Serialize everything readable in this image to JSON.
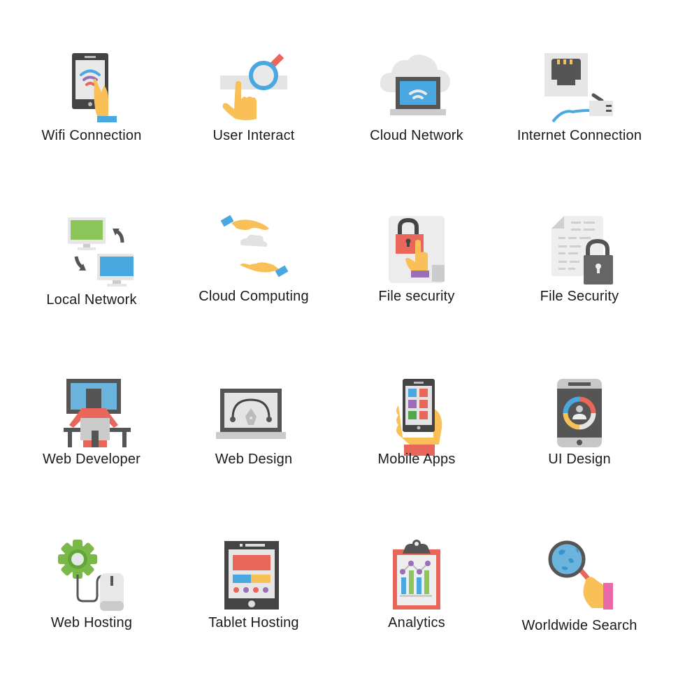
{
  "icons": [
    {
      "label": "Wifi Connection",
      "icon": "wifi-phone-icon"
    },
    {
      "label": "User Interact",
      "icon": "user-interact-icon"
    },
    {
      "label": "Cloud Network",
      "icon": "cloud-network-icon"
    },
    {
      "label": "Internet Connection",
      "icon": "ethernet-icon"
    },
    {
      "label": "Local Network",
      "icon": "local-network-icon"
    },
    {
      "label": "Cloud Computing",
      "icon": "cloud-hands-icon"
    },
    {
      "label": "File security",
      "icon": "file-lock-touch-icon"
    },
    {
      "label": "File Security",
      "icon": "document-lock-icon"
    },
    {
      "label": "Web Developer",
      "icon": "web-developer-icon"
    },
    {
      "label": "Web Design",
      "icon": "web-design-icon"
    },
    {
      "label": "Mobile Apps",
      "icon": "mobile-apps-icon"
    },
    {
      "label": "UI Design",
      "icon": "ui-design-icon"
    },
    {
      "label": "Web Hosting",
      "icon": "web-hosting-icon"
    },
    {
      "label": "Tablet Hosting",
      "icon": "tablet-hosting-icon"
    },
    {
      "label": "Analytics",
      "icon": "analytics-clipboard-icon"
    },
    {
      "label": "Worldwide Search",
      "icon": "globe-search-icon"
    }
  ],
  "colors": {
    "dark": "#555555",
    "light_gray": "#e6e6e6",
    "mid_gray": "#cccccc",
    "blue": "#4aa8e0",
    "red": "#e8665a",
    "yellow": "#f8c056",
    "green": "#8cc65a",
    "purple": "#9a6fb8",
    "pink": "#e86aa8"
  }
}
